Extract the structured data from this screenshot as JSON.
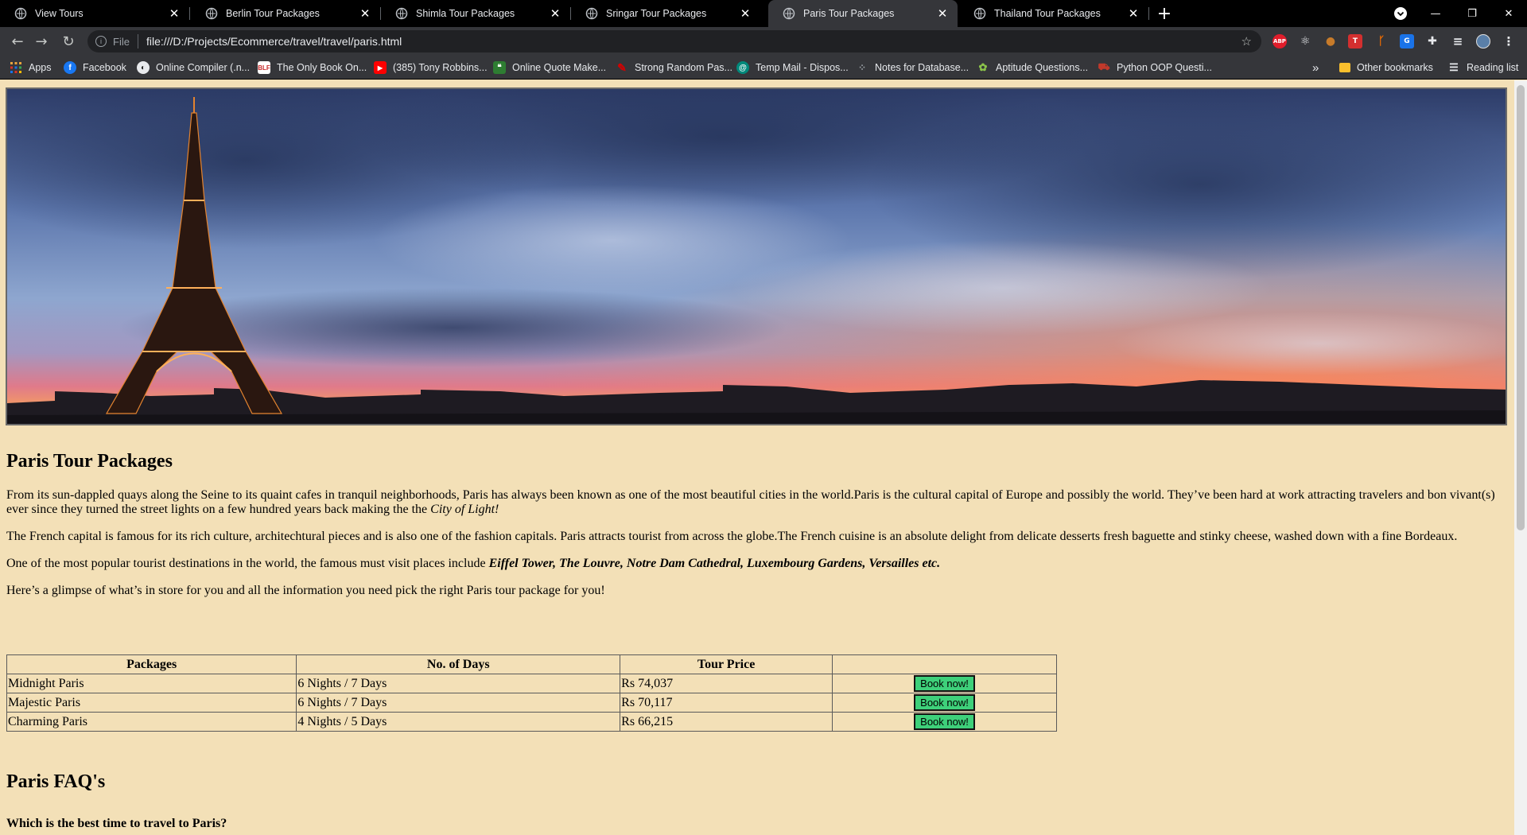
{
  "browser": {
    "tabs": [
      {
        "title": "View Tours",
        "active": false
      },
      {
        "title": "Berlin Tour Packages",
        "active": false
      },
      {
        "title": "Shimla Tour Packages",
        "active": false
      },
      {
        "title": "Sringar Tour Packages",
        "active": false
      },
      {
        "title": "Paris Tour Packages",
        "active": true
      },
      {
        "title": "Thailand Tour Packages",
        "active": false
      }
    ],
    "address": {
      "scheme": "File",
      "url": "file:///D:/Projects/Ecommerce/travel/travel/paris.html"
    },
    "extensions": [
      {
        "icon": "adblock-icon",
        "label": "ABP",
        "color": "#e11d2b"
      },
      {
        "icon": "react-devtools-icon",
        "label": "⚛",
        "color": "#35363a"
      },
      {
        "icon": "cookie-icon",
        "label": "●",
        "color": "#c77b2a"
      },
      {
        "icon": "translate-icon",
        "label": "T",
        "color": "#d32f2f"
      },
      {
        "icon": "wappalyzer-icon",
        "label": "ᚴ",
        "color": "#ef6c00"
      },
      {
        "icon": "google-translate-icon",
        "label": "G",
        "color": "#1a73e8"
      },
      {
        "icon": "puzzle-icon",
        "label": "✚",
        "color": "#35363a"
      },
      {
        "icon": "reading-list-icon",
        "label": "≡",
        "color": "#35363a"
      }
    ],
    "bookmarks": [
      {
        "label": "Apps",
        "icon": "apps-grid-icon",
        "color": "#d93025"
      },
      {
        "label": "Facebook",
        "icon": "facebook-icon",
        "color": "#1877f2"
      },
      {
        "label": "Online Compiler (.n...",
        "icon": "compiler-icon",
        "color": "#444"
      },
      {
        "label": "The Only Book On...",
        "icon": "book-icon",
        "color": "#c62828"
      },
      {
        "label": "(385) Tony Robbins...",
        "icon": "youtube-icon",
        "color": "#ff0000"
      },
      {
        "label": "Online Quote Make...",
        "icon": "quote-icon",
        "color": "#2e7d32"
      },
      {
        "label": "Strong Random Pas...",
        "icon": "password-icon",
        "color": "#d50000"
      },
      {
        "label": "Temp Mail - Dispos...",
        "icon": "mail-icon",
        "color": "#00897b"
      },
      {
        "label": "Notes for Database...",
        "icon": "notes-icon",
        "color": "#222"
      },
      {
        "label": "Aptitude Questions...",
        "icon": "aptitude-icon",
        "color": "#558b2f"
      },
      {
        "label": "Python OOP Questi...",
        "icon": "python-icon",
        "color": "#a1342e"
      }
    ],
    "overflow_label": "»",
    "other_bookmarks": "Other bookmarks",
    "reading_list": "Reading list"
  },
  "page": {
    "heading": "Paris Tour Packages",
    "p1_text": "From its sun-dappled quays along the Seine to its quaint cafes in tranquil neighborhoods, Paris has always been known as one of the most beautiful cities in the world.Paris is the cultural capital of Europe and possibly the world. They’ve been hard at work attracting travelers and bon vivant(s) ever since they turned the street lights on a few hundred years back making the the ",
    "p1_em": "City of Light!",
    "p2": "The French capital is famous for its rich culture, architechtural pieces and is also one of the fashion capitals. Paris attracts tourist from across the globe.The French cuisine is an absolute delight from delicate desserts fresh baguette and stinky cheese, washed down with a fine Bordeaux.",
    "p3_text": "One of the most popular tourist destinations in the world, the famous must visit places include ",
    "p3_strong": "Eiffel Tower, The Louvre, Notre Dam Cathedral, Luxembourg Gardens, Versailles etc.",
    "p4": "Here’s a glimpse of what’s in store for you and all the information you need pick the right Paris tour package for you!",
    "table": {
      "headers": [
        "Packages",
        "No. of Days",
        "Tour Price",
        ""
      ],
      "rows": [
        {
          "package": "Midnight Paris",
          "days": "6 Nights / 7 Days",
          "price": "Rs 74,037",
          "button": "Book now!"
        },
        {
          "package": "Majestic Paris",
          "days": "6 Nights / 7 Days",
          "price": "Rs 70,117",
          "button": "Book now!"
        },
        {
          "package": "Charming Paris",
          "days": "4 Nights / 5 Days",
          "price": "Rs 66,215",
          "button": "Book now!"
        }
      ]
    },
    "faq_heading": "Paris FAQ's",
    "faq_q1": "Which is the best time to travel to Paris?"
  }
}
